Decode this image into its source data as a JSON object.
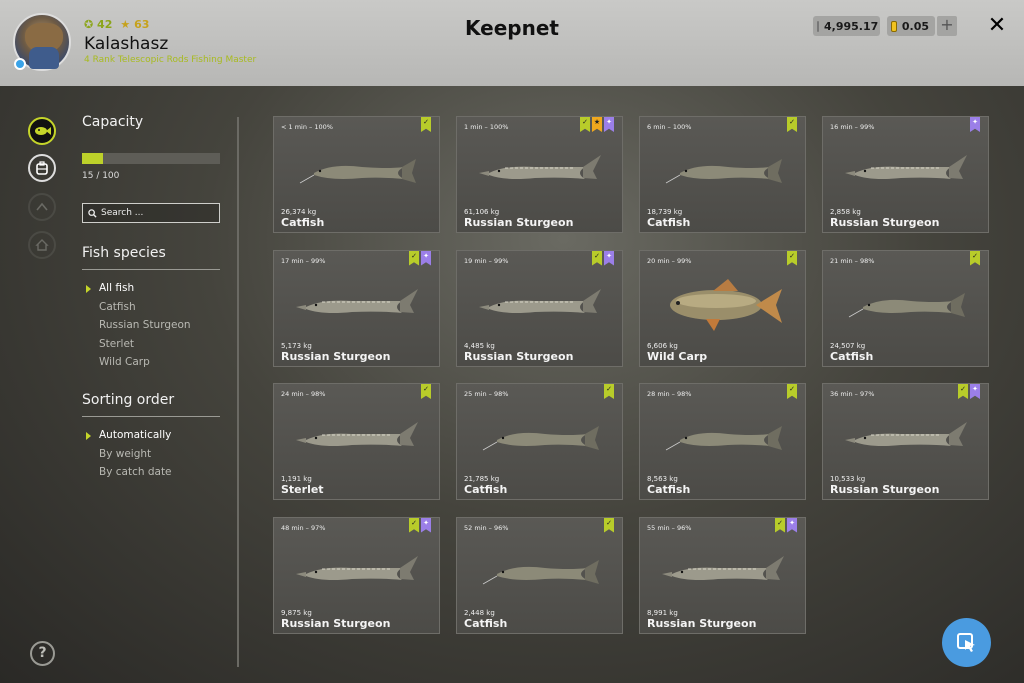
{
  "header": {
    "title": "Keepnet",
    "player": {
      "name": "Kalashasz",
      "rank": "4 Rank Telescopic Rods Fishing Master",
      "level": "42",
      "stars": "63"
    },
    "currency": {
      "silver": "4,995.17",
      "gold": "0.05"
    },
    "plus_label": "+",
    "close_label": "✕"
  },
  "left_nav": {
    "icons": [
      "fish-keepnet-icon",
      "backpack-icon",
      "tackle-icon",
      "home-icon"
    ],
    "help_label": "?"
  },
  "capacity": {
    "title": "Capacity",
    "current": 15,
    "max": 100,
    "text": "15 / 100",
    "fill_fraction": 0.15
  },
  "search": {
    "placeholder": "Search ..."
  },
  "species": {
    "title": "Fish species",
    "items": [
      "All fish",
      "Catfish",
      "Russian Sturgeon",
      "Sterlet",
      "Wild Carp"
    ],
    "selected": "All fish"
  },
  "sorting": {
    "title": "Sorting order",
    "items": [
      "Automatically",
      "By weight",
      "By catch date"
    ],
    "selected": "Automatically"
  },
  "colors": {
    "accent": "#c5d52a",
    "badge_check": "#b8cc2a",
    "badge_gold": "#f0a81e",
    "badge_purple": "#9b7fe8",
    "cursor_button": "#4a9be0"
  },
  "fish": [
    {
      "time": "< 1 min – 100%",
      "weight": "26,374 kg",
      "name": "Catfish",
      "badges": [
        "check"
      ]
    },
    {
      "time": "1 min – 100%",
      "weight": "61,106 kg",
      "name": "Russian Sturgeon",
      "badges": [
        "check",
        "gold",
        "purple"
      ]
    },
    {
      "time": "6 min – 100%",
      "weight": "18,739 kg",
      "name": "Catfish",
      "badges": [
        "check"
      ]
    },
    {
      "time": "16 min – 99%",
      "weight": "2,858 kg",
      "name": "Russian Sturgeon",
      "badges": [
        "purple"
      ]
    },
    {
      "time": "17 min – 99%",
      "weight": "5,173 kg",
      "name": "Russian Sturgeon",
      "badges": [
        "check",
        "purple"
      ]
    },
    {
      "time": "19 min – 99%",
      "weight": "4,485 kg",
      "name": "Russian Sturgeon",
      "badges": [
        "check",
        "purple"
      ]
    },
    {
      "time": "20 min – 99%",
      "weight": "6,606 kg",
      "name": "Wild Carp",
      "badges": [
        "check"
      ]
    },
    {
      "time": "21 min – 98%",
      "weight": "24,507 kg",
      "name": "Catfish",
      "badges": [
        "check"
      ]
    },
    {
      "time": "24 min – 98%",
      "weight": "1,191 kg",
      "name": "Sterlet",
      "badges": [
        "check"
      ]
    },
    {
      "time": "25 min – 98%",
      "weight": "21,785 kg",
      "name": "Catfish",
      "badges": [
        "check"
      ]
    },
    {
      "time": "28 min – 98%",
      "weight": "8,563 kg",
      "name": "Catfish",
      "badges": [
        "check"
      ]
    },
    {
      "time": "36 min – 97%",
      "weight": "10,533 kg",
      "name": "Russian Sturgeon",
      "badges": [
        "check",
        "purple"
      ]
    },
    {
      "time": "48 min – 97%",
      "weight": "9,875 kg",
      "name": "Russian Sturgeon",
      "badges": [
        "check",
        "purple"
      ]
    },
    {
      "time": "52 min – 96%",
      "weight": "2,448 kg",
      "name": "Catfish",
      "badges": [
        "check"
      ]
    },
    {
      "time": "55 min – 96%",
      "weight": "8,991 kg",
      "name": "Russian Sturgeon",
      "badges": [
        "check",
        "purple"
      ]
    }
  ]
}
